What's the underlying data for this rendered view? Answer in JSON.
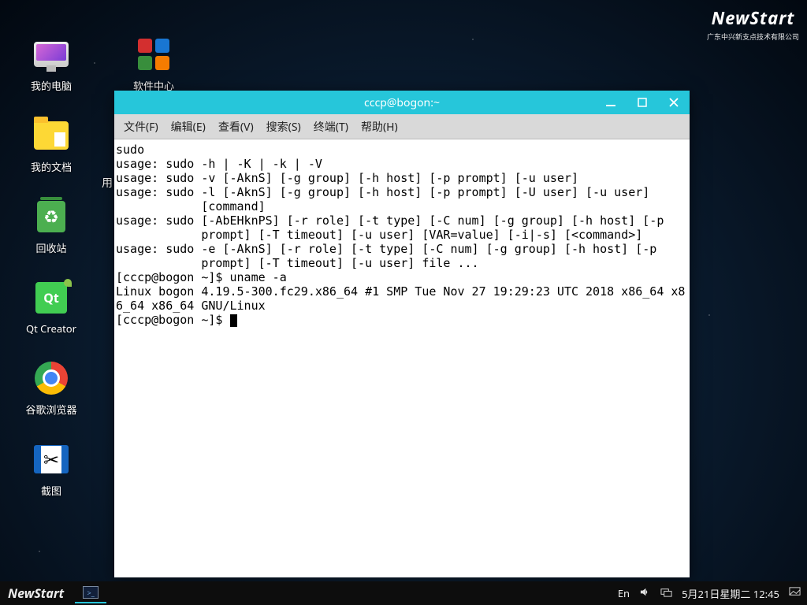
{
  "brand": {
    "name": "NewStart",
    "sub": "广东中兴新支点技术有限公司"
  },
  "desktop": {
    "computer": "我的电脑",
    "documents": "我的文档",
    "trash": "回收站",
    "qt": "Qt Creator",
    "chrome": "谷歌浏览器",
    "screenshot": "截图",
    "apps": "软件中心",
    "cut_hint": "用"
  },
  "window": {
    "title": "cccp@bogon:~",
    "menu": {
      "file": "文件(F)",
      "edit": "编辑(E)",
      "view": "查看(V)",
      "search": "搜索(S)",
      "terminal": "终端(T)",
      "help": "帮助(H)"
    },
    "lines": {
      "l0": "sudo",
      "l1": "usage: sudo -h | -K | -k | -V",
      "l2": "usage: sudo -v [-AknS] [-g group] [-h host] [-p prompt] [-u user]",
      "l3": "usage: sudo -l [-AknS] [-g group] [-h host] [-p prompt] [-U user] [-u user]",
      "l4": "            [command]",
      "l5": "usage: sudo [-AbEHknPS] [-r role] [-t type] [-C num] [-g group] [-h host] [-p",
      "l6": "            prompt] [-T timeout] [-u user] [VAR=value] [-i|-s] [<command>]",
      "l7": "usage: sudo -e [-AknS] [-r role] [-t type] [-C num] [-g group] [-h host] [-p",
      "l8": "            prompt] [-T timeout] [-u user] file ...",
      "l9": "[cccp@bogon ~]$ uname -a",
      "l10": "Linux bogon 4.19.5-300.fc29.x86_64 #1 SMP Tue Nov 27 19:29:23 UTC 2018 x86_64 x8",
      "l11": "6_64 x86_64 GNU/Linux",
      "l12": "[cccp@bogon ~]$ "
    }
  },
  "taskbar": {
    "start": "NewStart",
    "lang": "En",
    "clock": "5月21日星期二 12:45"
  }
}
